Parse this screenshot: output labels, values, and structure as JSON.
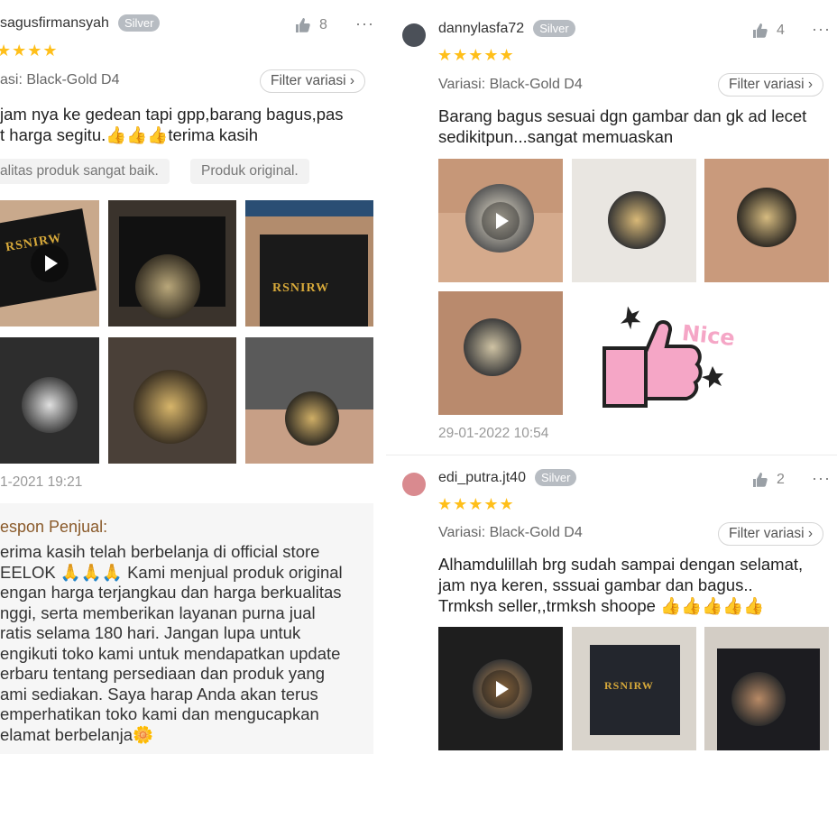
{
  "left_review": {
    "username": "sagusfirmansyah",
    "badge": "Silver",
    "likes": "8",
    "stars": "★★★★",
    "variant": "asi: Black-Gold D4",
    "filter_label": "Filter variasi",
    "filter_chevron": "›",
    "text_line1": "jam nya ke gedean tapi gpp,barang bagus,pas",
    "text_line2": "t harga segitu.👍👍👍terima kasih",
    "tags": [
      "alitas produk sangat baik.",
      "Produk original."
    ],
    "box_logo": "RSNIRW",
    "date": "1-2021 19:21",
    "seller_reply_title": "espon Penjual:",
    "seller_reply_lines": [
      "erima kasih telah berbelanja di official store",
      "EELOK 🙏🙏🙏 Kami menjual produk original",
      "engan harga terjangkau dan harga berkualitas",
      "nggi, serta memberikan layanan purna jual",
      "ratis selama 180 hari. Jangan lupa untuk",
      "engikuti toko kami untuk mendapatkan update",
      "erbaru tentang persediaan dan produk yang",
      "ami sediakan. Saya harap Anda akan terus",
      "emperhatikan toko kami dan mengucapkan",
      "elamat berbelanja🌼"
    ]
  },
  "review_1": {
    "username": "dannylasfa72",
    "badge": "Silver",
    "likes": "4",
    "stars": "★★★★★",
    "variant": "Variasi: Black-Gold D4",
    "filter_label": "Filter variasi",
    "filter_chevron": "›",
    "text_line1": "Barang bagus sesuai dgn gambar dan gk ad lecet",
    "text_line2": "sedikitpun...sangat memuaskan",
    "sticker_text": "Nice",
    "date": "29-01-2022 10:54"
  },
  "review_2": {
    "username": "edi_putra.jt40",
    "badge": "Silver",
    "likes": "2",
    "stars": "★★★★★",
    "variant": "Variasi: Black-Gold D4",
    "filter_label": "Filter variasi",
    "filter_chevron": "›",
    "text_line1": "Alhamdulillah brg sudah sampai dengan selamat,",
    "text_line2": "jam nya keren, sssuai gambar dan bagus..",
    "text_line3": "Trmksh seller,,trmksh shoope 👍👍👍👍👍",
    "box_logo": "RSNIRW"
  },
  "more_icon": "···",
  "colors": {
    "star": "#ffbf1a",
    "badge": "#b7bcc2",
    "reply_title": "#8a5a2a",
    "sticker_pink": "#f5a6c6"
  }
}
